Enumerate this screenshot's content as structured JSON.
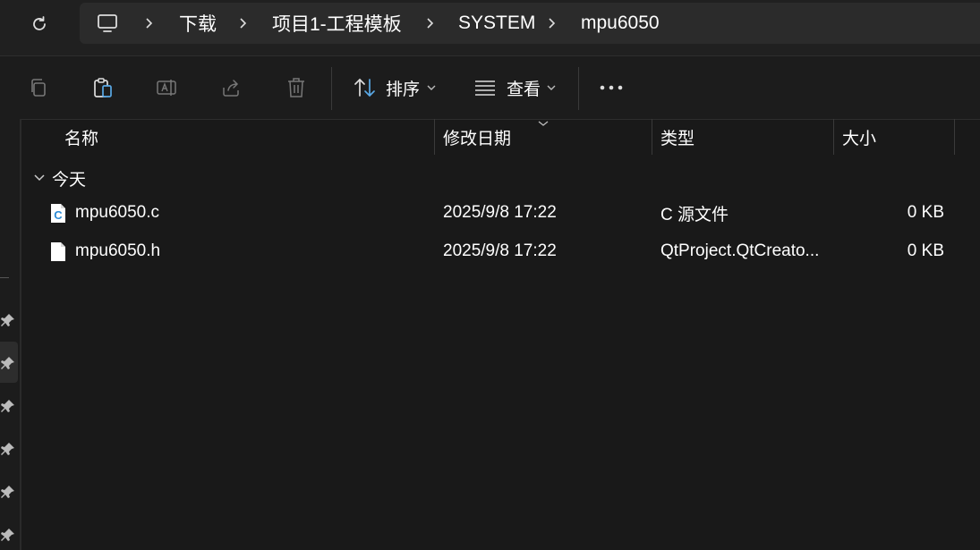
{
  "breadcrumb": {
    "items": [
      "下载",
      "项目1-工程模板",
      "SYSTEM",
      "mpu6050"
    ]
  },
  "toolbar": {
    "sort_label": "排序",
    "view_label": "查看"
  },
  "columns": {
    "name": "名称",
    "date": "修改日期",
    "type": "类型",
    "size": "大小"
  },
  "group": {
    "label": "今天"
  },
  "files": [
    {
      "name": "mpu6050.c",
      "date": "2025/9/8 17:22",
      "type": "C 源文件",
      "size": "0 KB",
      "icon": "c-source-file-icon"
    },
    {
      "name": "mpu6050.h",
      "date": "2025/9/8 17:22",
      "type": "QtProject.QtCreato...",
      "size": "0 KB",
      "icon": "header-file-icon"
    }
  ],
  "colors": {
    "background": "#191919",
    "address_bar": "#2b2b2b",
    "c_icon_accent": "#2b8bd6"
  }
}
